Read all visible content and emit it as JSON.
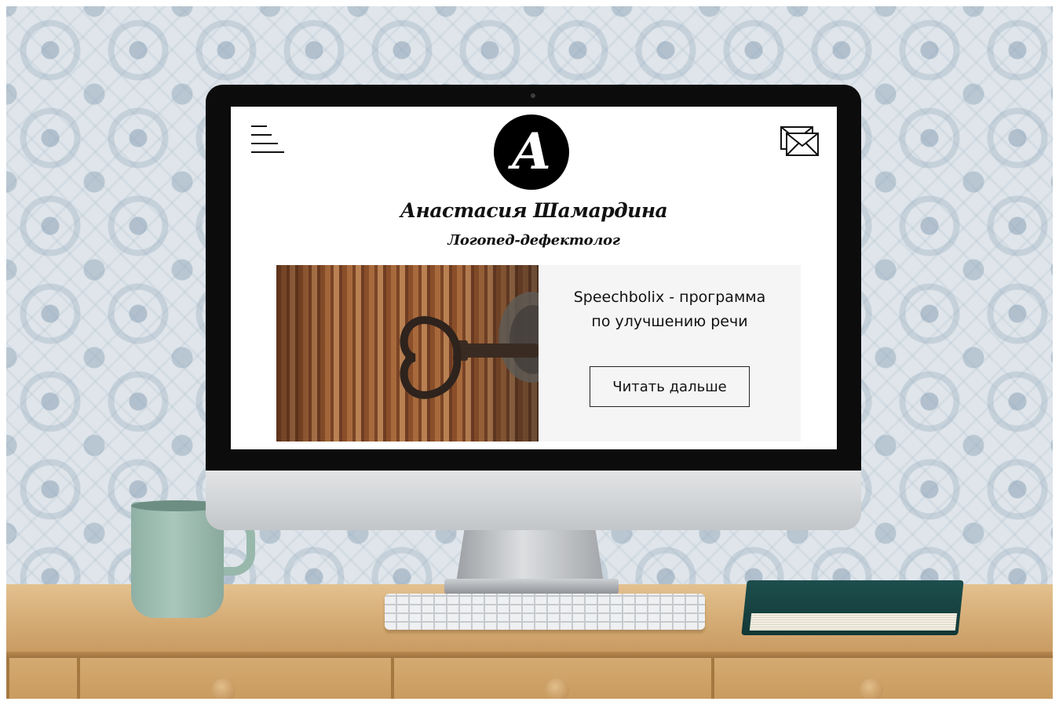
{
  "site": {
    "logo_letter": "A",
    "name": "Анастасия Шамардина",
    "role": "Логопед-дефектолог"
  },
  "header": {
    "menu_icon": "hamburger-menu-icon",
    "mail_icon": "envelope-icon"
  },
  "promo": {
    "image": "old-key-in-lock-photo",
    "line1": "Speechbolix - программа",
    "line2": "по улучшению речи",
    "button_label": "Читать дальше"
  },
  "colors": {
    "page_background": "#ffffff",
    "promo_background": "#f5f5f5",
    "text": "#111111",
    "logo_background": "#000000"
  }
}
